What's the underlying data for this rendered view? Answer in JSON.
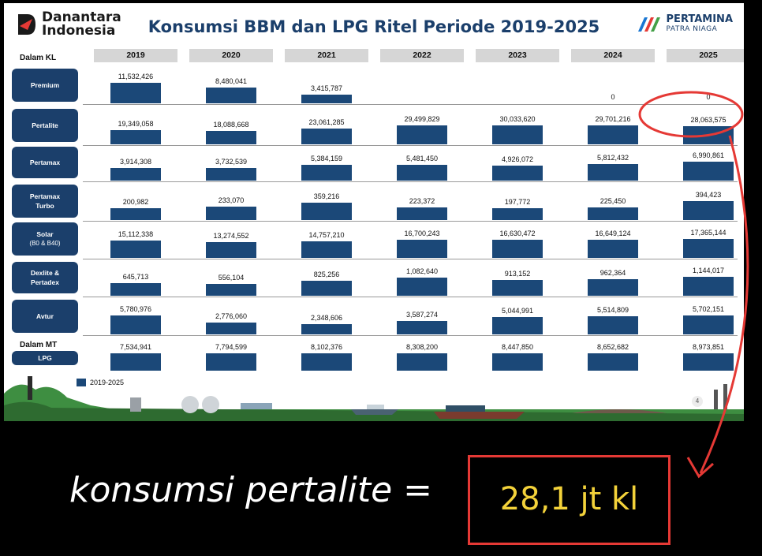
{
  "header": {
    "left_logo": "Danantara Indonesia",
    "title": "Konsumsi BBM dan LPG Ritel Periode 2019-2025",
    "right_logo_name": "PERTAMINA",
    "right_logo_sub": "PATRA NIAGA"
  },
  "chart_data": {
    "type": "bar",
    "title": "Konsumsi BBM dan LPG Ritel Periode 2019-2025",
    "x": [
      "2019",
      "2020",
      "2021",
      "2022",
      "2023",
      "2024",
      "2025"
    ],
    "unit_labels": {
      "kl": "Dalam KL",
      "mt": "Dalam MT"
    },
    "legend": [
      "2019-2025"
    ],
    "series": [
      {
        "name": "Premium",
        "labels": [
          "11,532,426",
          "8,480,041",
          "3,415,787",
          "",
          "",
          "0",
          "0"
        ],
        "values": [
          11532426,
          8480041,
          3415787,
          null,
          null,
          0,
          0
        ]
      },
      {
        "name": "Pertalite",
        "labels": [
          "19,349,058",
          "18,088,668",
          "23,061,285",
          "29,499,829",
          "30,033,620",
          "29,701,216",
          "28,063,575"
        ],
        "values": [
          19349058,
          18088668,
          23061285,
          29499829,
          30033620,
          29701216,
          28063575
        ]
      },
      {
        "name": "Pertamax",
        "labels": [
          "3,914,308",
          "3,732,539",
          "5,384,159",
          "5,481,450",
          "4,926,072",
          "5,812,432",
          "6,990,861"
        ],
        "values": [
          3914308,
          3732539,
          5384159,
          5481450,
          4926072,
          5812432,
          6990861
        ]
      },
      {
        "name": "Pertamax Turbo",
        "labels": [
          "200,982",
          "233,070",
          "359,216",
          "223,372",
          "197,772",
          "225,450",
          "394,423"
        ],
        "values": [
          200982,
          233070,
          359216,
          223372,
          197772,
          225450,
          394423
        ]
      },
      {
        "name": "Solar",
        "sub": "(B0 & B40)",
        "labels": [
          "15,112,338",
          "13,274,552",
          "14,757,210",
          "16,700,243",
          "16,630,472",
          "16,649,124",
          "17,365,144"
        ],
        "values": [
          15112338,
          13274552,
          14757210,
          16700243,
          16630472,
          16649124,
          17365144
        ]
      },
      {
        "name": "Dexlite & Pertadex",
        "labels": [
          "645,713",
          "556,104",
          "825,256",
          "1,082,640",
          "913,152",
          "962,364",
          "1,144,017"
        ],
        "values": [
          645713,
          556104,
          825256,
          1082640,
          913152,
          962364,
          1144017
        ]
      },
      {
        "name": "Avtur",
        "labels": [
          "5,780,976",
          "2,776,060",
          "2,348,606",
          "3,587,274",
          "5,044,991",
          "5,514,809",
          "5,702,151"
        ],
        "values": [
          5780976,
          2776060,
          2348606,
          3587274,
          5044991,
          5514809,
          5702151
        ]
      },
      {
        "name": "LPG",
        "labels": [
          "7,534,941",
          "7,794,599",
          "8,102,376",
          "8,308,200",
          "8,447,850",
          "8,652,682",
          "8,973,851"
        ],
        "values": [
          7534941,
          7794599,
          8102376,
          8308200,
          8447850,
          8652682,
          8973851
        ]
      }
    ]
  },
  "page_number": "4",
  "annotation": {
    "text": "konsumsi pertalite =",
    "value": "28,1 jt kl",
    "circle_color": "#e53935",
    "value_color": "#f3d23a"
  }
}
